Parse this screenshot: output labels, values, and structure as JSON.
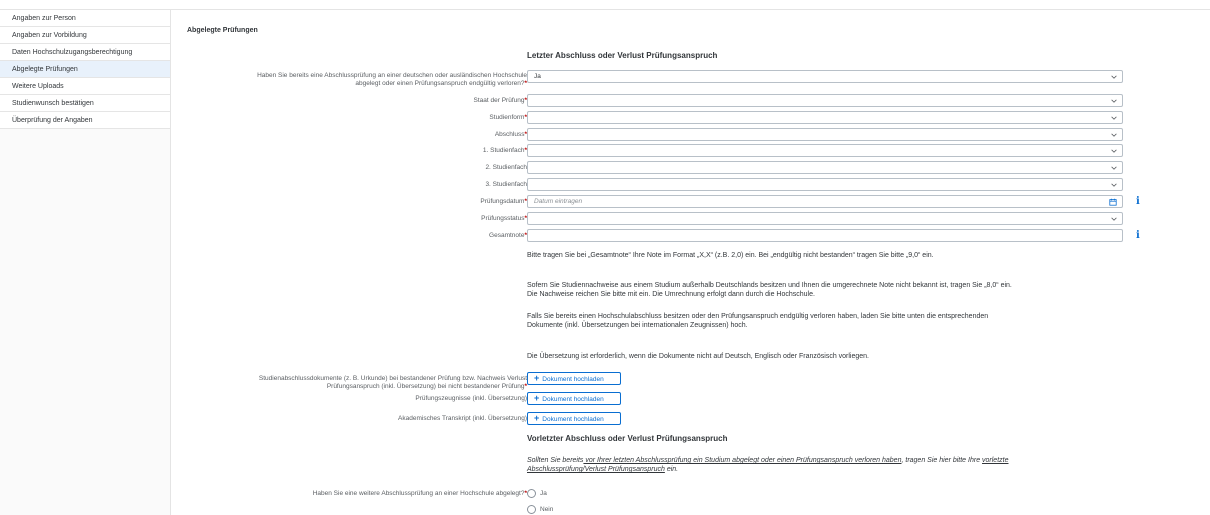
{
  "sidebar": {
    "items": [
      {
        "label": "Angaben zur Person"
      },
      {
        "label": "Angaben zur Vorbildung"
      },
      {
        "label": "Daten Hochschulzugangsberechtigung"
      },
      {
        "label": "Abgelegte Prüfungen"
      },
      {
        "label": "Weitere Uploads"
      },
      {
        "label": "Studienwunsch bestätigen"
      },
      {
        "label": "Überprüfung der Angaben"
      }
    ],
    "active_index": 3
  },
  "main": {
    "section_title": "Abgelegte Prüfungen",
    "heading_last": "Letzter Abschluss oder Verlust Prüfungsanspruch",
    "q_exam_line1": "Haben Sie bereits eine Abschlussprüfung an einer deutschen oder ausländischen Hochschule",
    "q_exam_line2": "abgelegt oder einen Prüfungsanspruch endgültig verloren?",
    "q_exam_value": "Ja",
    "fields": {
      "staat": {
        "label": "Staat der Prüfung",
        "value": ""
      },
      "studienform": {
        "label": "Studienform",
        "value": ""
      },
      "abschluss": {
        "label": "Abschluss",
        "value": ""
      },
      "fach1": {
        "label": "1. Studienfach",
        "value": ""
      },
      "fach2": {
        "label": "2. Studienfach",
        "value": ""
      },
      "fach3": {
        "label": "3. Studienfach",
        "value": ""
      },
      "datum": {
        "label": "Prüfungsdatum",
        "placeholder": "Datum eintragen"
      },
      "status": {
        "label": "Prüfungsstatus",
        "value": ""
      },
      "note": {
        "label": "Gesamtnote",
        "value": ""
      }
    },
    "info_symbol": "i",
    "required_mark": "*",
    "para1": "Bitte tragen Sie bei „Gesamtnote“ Ihre Note im Format „X,X“ (z.B. 2,0) ein. Bei „endgültig nicht bestanden“ tragen Sie bitte „9,0“ ein.",
    "para2_line1": "Sofern Sie Studiennachweise aus einem Studium außerhalb Deutschlands besitzen und Ihnen die umgerechnete Note nicht bekannt ist, tragen Sie „8,0“ ein.",
    "para2_line2": "Die Nachweise reichen Sie bitte mit ein. Die Umrechnung erfolgt dann durch die Hochschule.",
    "para3_line1": "Falls Sie bereits einen Hochschulabschluss besitzen oder den Prüfungsanspruch endgültig verloren haben, laden Sie bitte unten die entsprechenden",
    "para3_line2": "Dokumente (inkl. Übersetzungen bei internationalen Zeugnissen) hoch.",
    "para4": "Die Übersetzung ist erforderlich, wenn die Dokumente nicht auf Deutsch, Englisch oder Französisch vorliegen.",
    "uploads": {
      "doc1_line1": "Studienabschlussdokumente (z. B. Urkunde) bei bestandener Prüfung bzw. Nachweis Verlust",
      "doc1_line2": "Prüfungsanspruch (inkl. Übersetzung) bei nicht bestandener Prüfung",
      "doc2": "Prüfungszeugnisse (inkl. Übersetzung)",
      "doc3": "Akademisches Transkript (inkl. Übersetzung)",
      "button_label": "Dokument hochladen",
      "button_plus": "+"
    },
    "heading_prev": "Vorletzter Abschluss oder Verlust Prüfungsanspruch",
    "note_prev_a": "Sollten Sie bereits",
    "note_prev_b": " vor Ihrer letzten Abschlussprüfung ein Studium abgelegt oder einen Prüfungsanspruch verloren haben",
    "note_prev_c": ", tragen Sie hier bitte Ihre ",
    "note_prev_d": "vorletzte",
    "note_prev_e": "Abschlussprüfung/Verlust Prüfungsanspruch",
    "note_prev_f": " ein.",
    "q_further": "Haben Sie eine weitere Abschlussprüfung an einer Hochschule abgelegt?",
    "radio_yes": "Ja",
    "radio_no": "Nein"
  },
  "colors": {
    "accent": "#0a6ed1",
    "required": "#bb0000",
    "active_sidebar": "#e8f1fb"
  }
}
